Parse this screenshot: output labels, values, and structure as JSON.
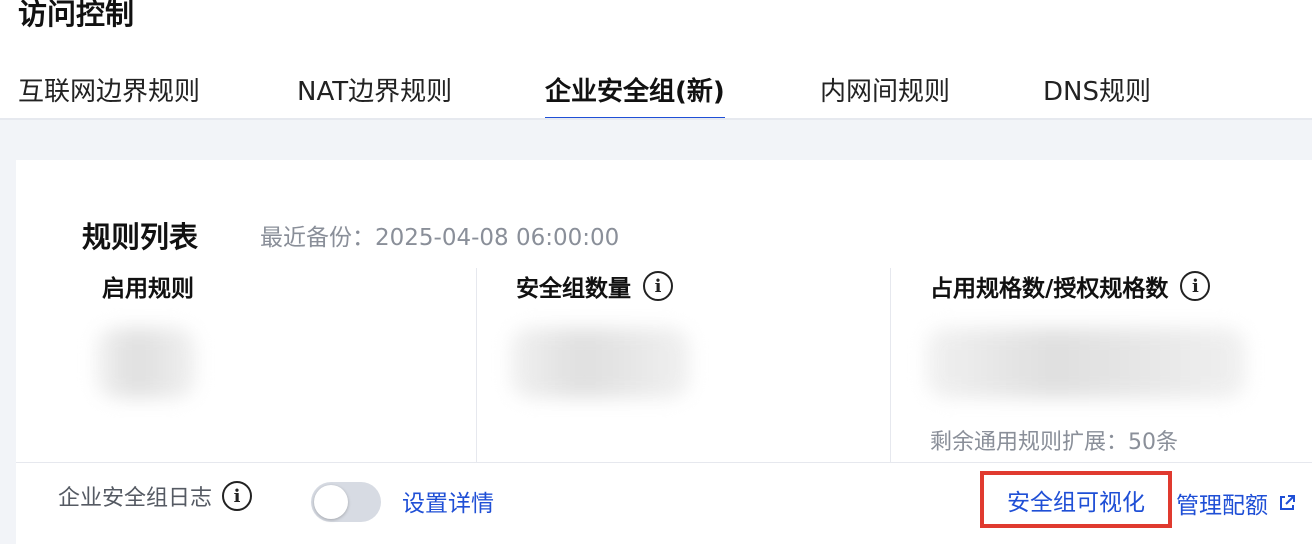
{
  "page": {
    "title": "访问控制"
  },
  "tabs": [
    {
      "label": "互联网边界规则",
      "active": false
    },
    {
      "label": "NAT边界规则",
      "active": false
    },
    {
      "label": "企业安全组(新)",
      "active": true
    },
    {
      "label": "内网间规则",
      "active": false
    },
    {
      "label": "DNS规则",
      "active": false
    }
  ],
  "card": {
    "title": "规则列表",
    "backup_text": "最近备份：2025-04-08 06:00:00",
    "stats": [
      {
        "label": "启用规则",
        "has_info": false
      },
      {
        "label": "安全组数量",
        "has_info": true
      },
      {
        "label": "占用规格数/授权规格数",
        "has_info": true
      }
    ],
    "remaining_text": "剩余通用规则扩展：50条"
  },
  "footer": {
    "log_label": "企业安全组日志",
    "toggle_on": false,
    "settings_link": "设置详情",
    "visualize_link": "安全组可视化",
    "manage_link": "管理配额"
  },
  "icons": {
    "info": "info-circle-icon",
    "external": "external-link-icon"
  },
  "colors": {
    "accent": "#1f4fd6",
    "highlight_border": "#e03a2f",
    "page_bg": "#f2f4f8"
  },
  "glyphs": {
    "info": "i"
  }
}
